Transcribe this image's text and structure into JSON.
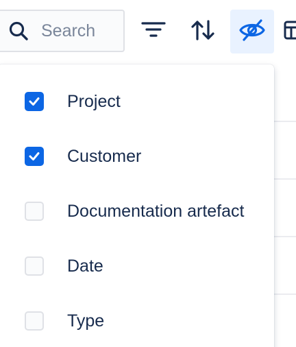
{
  "toolbar": {
    "search": {
      "placeholder": "Search",
      "value": "",
      "icon": "search-icon"
    },
    "buttons": [
      {
        "name": "filter",
        "icon": "filter-icon",
        "active": false
      },
      {
        "name": "sort",
        "icon": "sort-arrows-icon",
        "active": false
      },
      {
        "name": "hide-fields",
        "icon": "eye-hidden-icon",
        "active": true
      },
      {
        "name": "more",
        "icon": "view-icon",
        "active": false
      }
    ]
  },
  "field_menu": {
    "options": [
      {
        "label": "Project",
        "checked": true
      },
      {
        "label": "Customer",
        "checked": true
      },
      {
        "label": "Documentation artefact",
        "checked": false
      },
      {
        "label": "Date",
        "checked": false
      },
      {
        "label": "Type",
        "checked": false
      }
    ]
  },
  "colors": {
    "accent": "#0c66e4",
    "active_button_bg": "#e9f2ff",
    "text": "#172b4d",
    "placeholder": "#7a869a",
    "border": "#dfe1e6"
  }
}
